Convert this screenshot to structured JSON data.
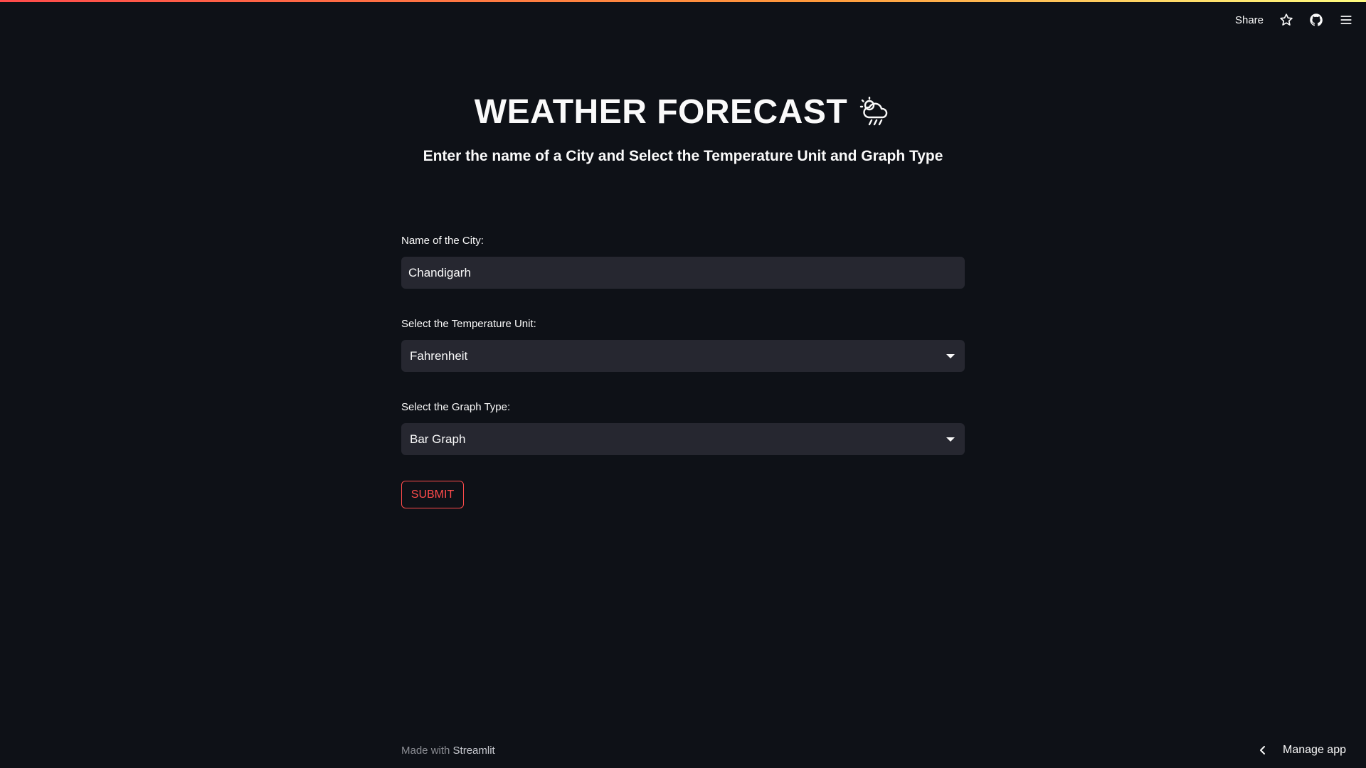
{
  "toolbar": {
    "share_label": "Share",
    "icons": [
      "star-icon",
      "github-icon",
      "hamburger-menu-icon"
    ]
  },
  "header": {
    "title": "WEATHER FORECAST",
    "title_icon": "cloud-rain-icon",
    "subtitle": "Enter the name of a City and Select the Temperature Unit and Graph Type"
  },
  "form": {
    "city": {
      "label": "Name of the City:",
      "value": "Chandigarh"
    },
    "unit": {
      "label": "Select the Temperature Unit:",
      "value": "Fahrenheit"
    },
    "graph": {
      "label": "Select the Graph Type:",
      "value": "Bar Graph"
    },
    "submit_label": "SUBMIT"
  },
  "footer": {
    "made_with": "Made with",
    "brand": "Streamlit",
    "manage_label": "Manage app"
  },
  "colors": {
    "background": "#0e1117",
    "input_bg": "#262730",
    "accent": "#ff4b4b"
  }
}
